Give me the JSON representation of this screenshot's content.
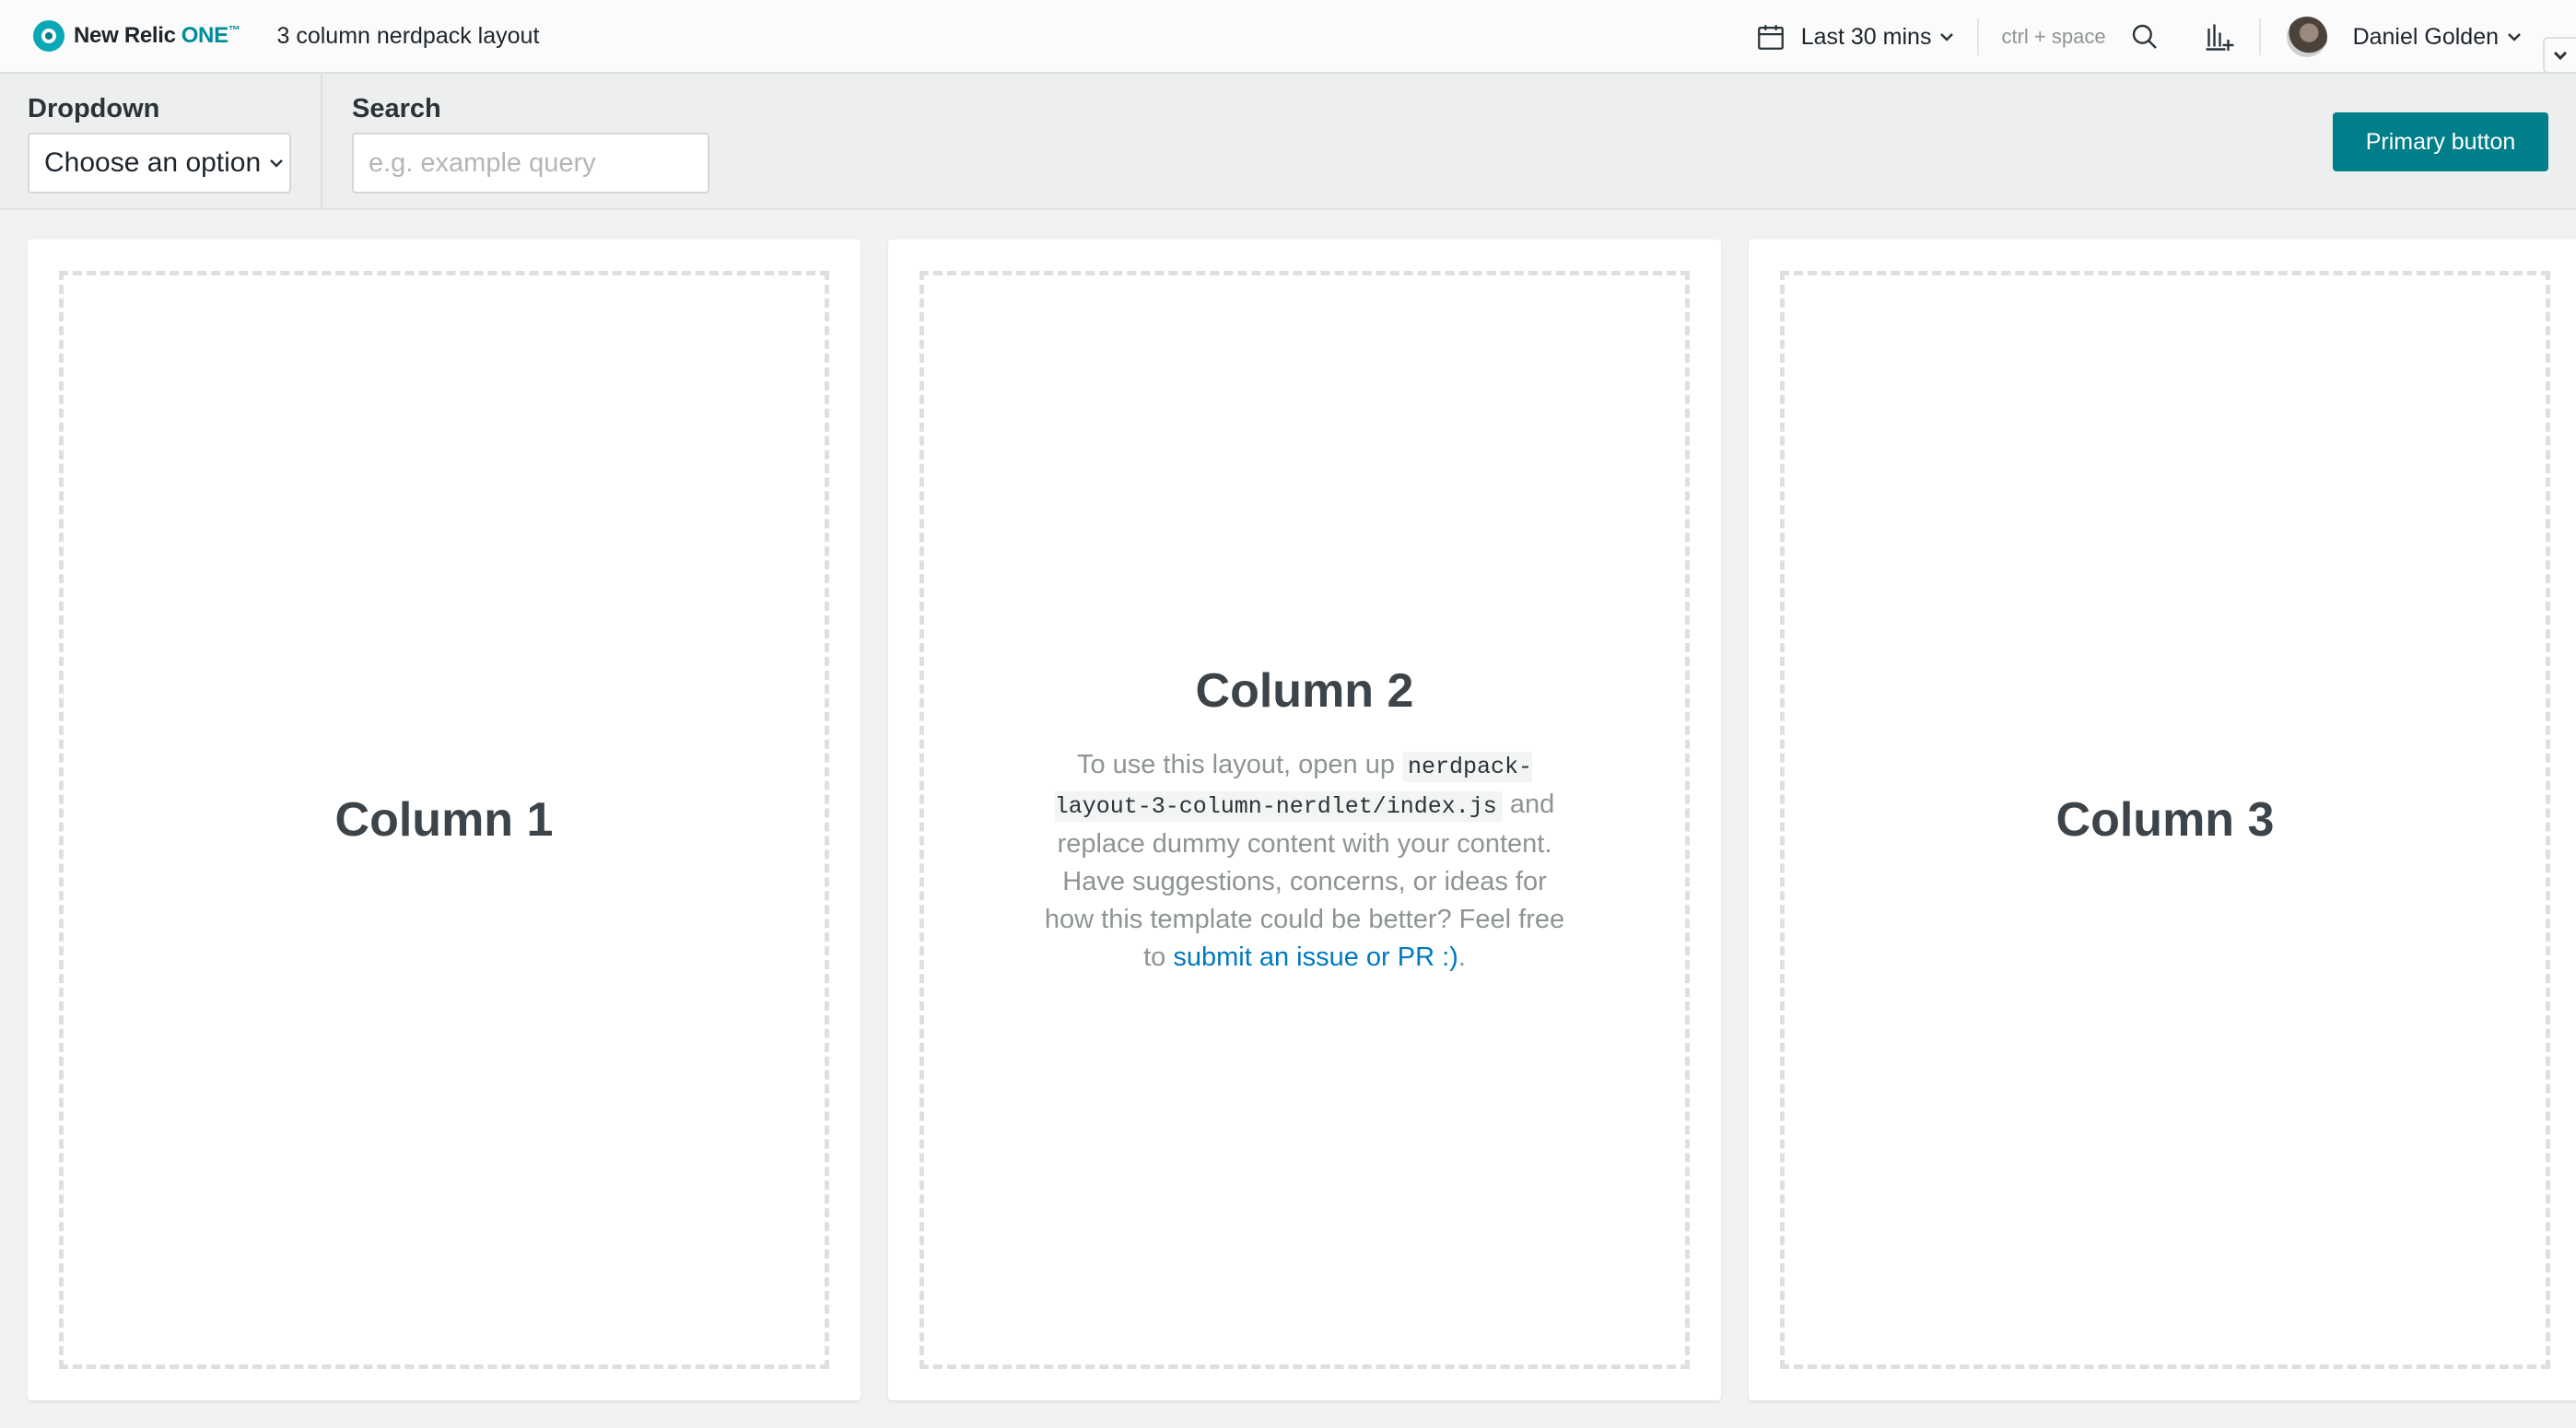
{
  "header": {
    "brand": "New Relic",
    "brand_accent": "ONE",
    "brand_tm": "™",
    "app_title": "3 column nerdpack layout",
    "time_range": "Last 30 mins",
    "shortcut_hint": "ctrl + space",
    "user_name": "Daniel Golden"
  },
  "toolbar": {
    "dropdown_label": "Dropdown",
    "dropdown_value": "Choose an option",
    "search_label": "Search",
    "search_placeholder": "e.g. example query",
    "primary_button": "Primary button"
  },
  "columns": [
    {
      "heading": "Column 1"
    },
    {
      "heading": "Column 2",
      "body_prefix": "To use this layout, open up ",
      "code": "nerdpack-layout-3-column-nerdlet/index.js",
      "body_middle": " and replace dummy content with your content. Have suggestions, concerns, or ideas for how this template could be better? Feel free to ",
      "link_text": "submit an issue or PR :)",
      "body_suffix": "."
    },
    {
      "heading": "Column 3"
    }
  ],
  "icons": {
    "logo": "new-relic-logo",
    "calendar": "calendar-icon",
    "search": "search-icon",
    "chart_add": "chart-add-icon",
    "chevron": "chevron-down-icon"
  },
  "colors": {
    "accent": "#007e8a",
    "brand": "#008c99",
    "link": "#0079bf"
  }
}
